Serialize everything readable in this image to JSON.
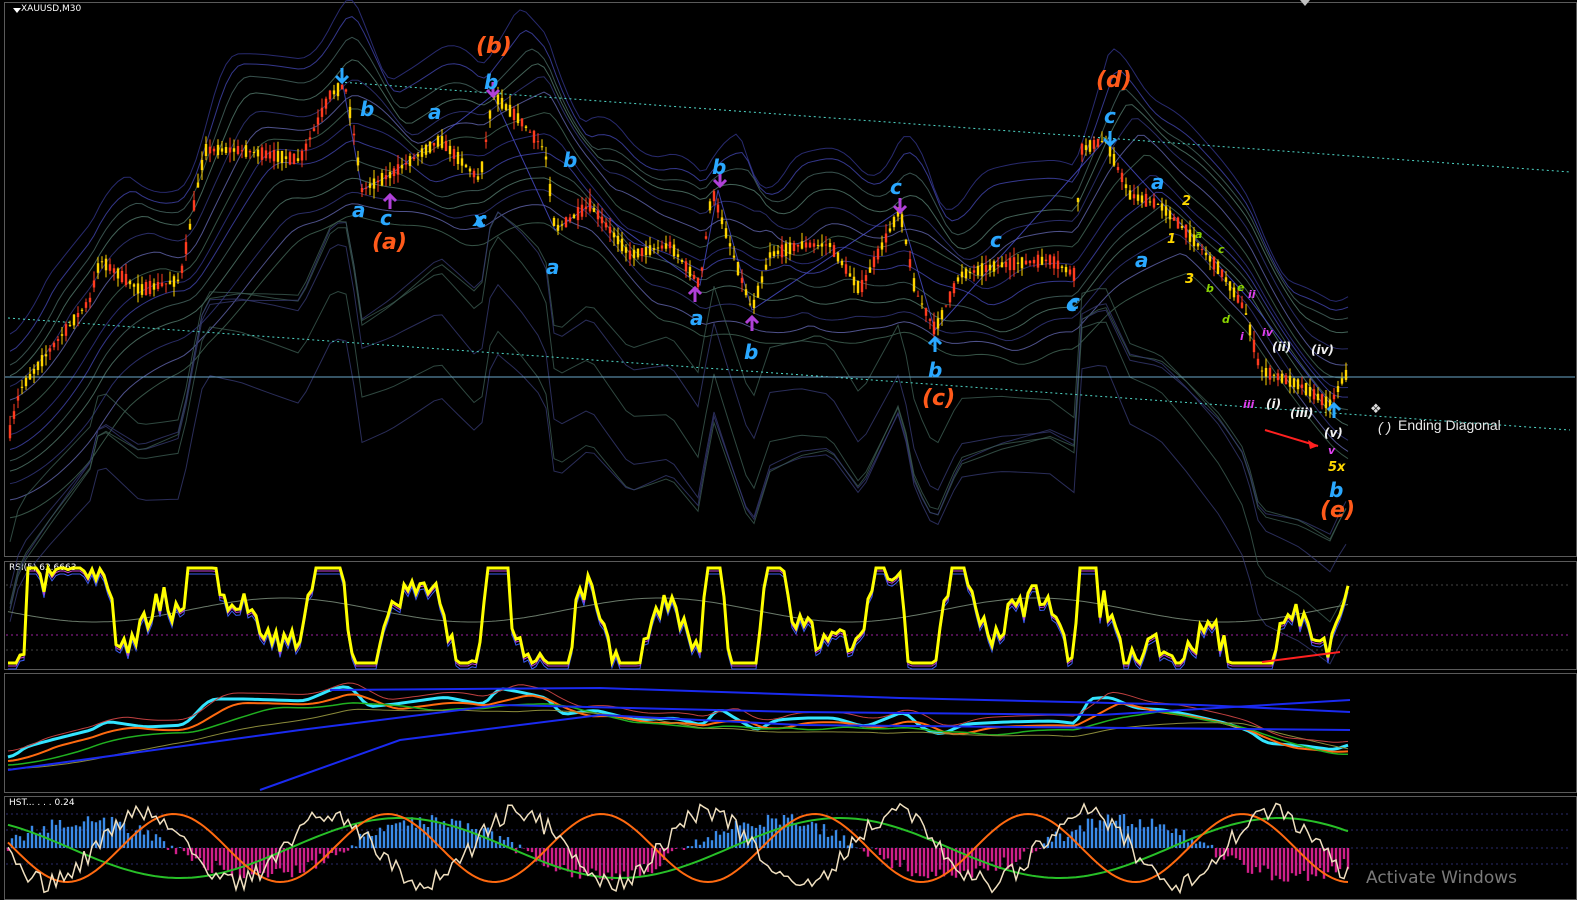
{
  "chart_title": "XAUUSD,M30",
  "rsi_title": "RSI(5) 62.6663",
  "osc_title": "HST...  .  .  . 0.24",
  "ending_label": "Ending Diagonal",
  "ending_bracket": "( )",
  "watermark": "Activate Windows",
  "colors": {
    "background": "#000000",
    "bull_candle": "#ffd400",
    "bear_candle": "#ff3b1f",
    "wave_blue": "#2aa8ff",
    "wave_orange": "#ff5a1a",
    "rsi_line": "#ffff00",
    "ma_cyan": "#33e5ff"
  },
  "wave_labels": {
    "orange": [
      "(b)",
      "(a)",
      "(d)",
      "(c)",
      "(e)"
    ],
    "blue": [
      "b",
      "a",
      "c",
      "a",
      "c",
      "b",
      "b",
      "a",
      "x",
      "b",
      "c",
      "a",
      "b",
      "c",
      "a",
      "c",
      "c",
      "a",
      "b",
      "b",
      "c"
    ],
    "yellow": [
      "2",
      "1",
      "3",
      "5x"
    ],
    "green": [
      "a",
      "c",
      "b",
      "e",
      "d"
    ],
    "magenta": [
      "ii",
      "iv",
      "i",
      "iii",
      "v"
    ],
    "white": [
      "(ii)",
      "(iv)",
      "(i)",
      "(iii)",
      "(v)"
    ]
  },
  "chart_data": {
    "type": "candlestick",
    "title": "XAUUSD,M30",
    "close_trend": [
      18,
      45,
      62,
      78,
      80,
      70,
      90,
      72,
      82,
      66,
      52,
      66,
      88,
      80,
      71,
      60,
      68,
      58,
      60,
      55,
      52,
      47,
      44,
      48,
      42,
      52,
      46,
      50,
      49,
      44,
      42,
      43,
      40,
      42,
      50,
      54,
      48,
      46,
      41,
      40,
      35,
      28,
      20,
      10,
      8,
      7,
      6,
      5,
      4,
      7
    ],
    "indicators": [
      "RSI(5)",
      "Moving averages",
      "Histogram oscillator"
    ]
  }
}
